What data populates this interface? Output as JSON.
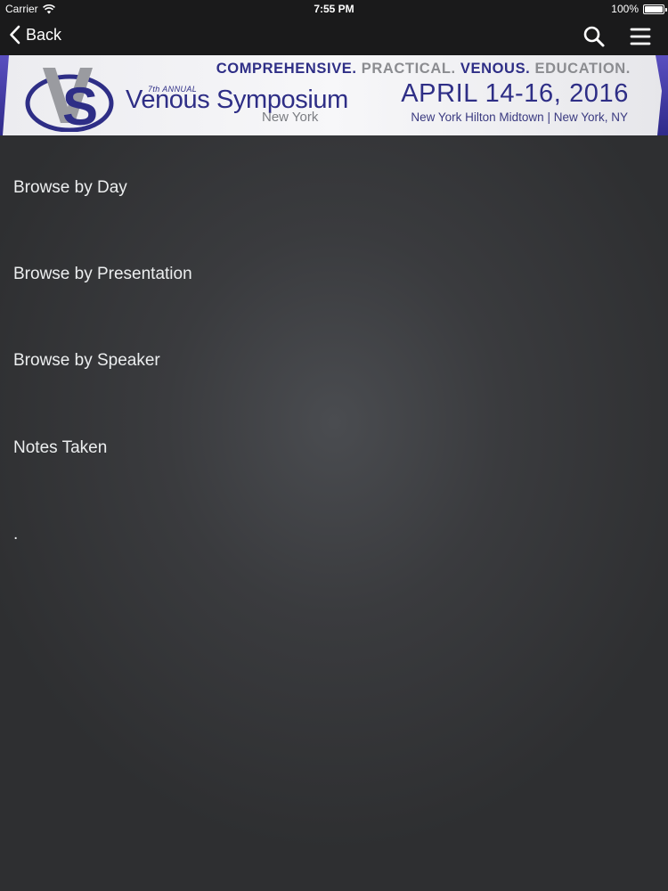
{
  "status_bar": {
    "carrier": "Carrier",
    "time": "7:55 PM",
    "battery": "100%",
    "battery_level": 1.0
  },
  "nav": {
    "back_label": "Back",
    "icons": [
      "search-icon",
      "hamburger-menu-icon",
      "chevron-left-icon"
    ]
  },
  "banner": {
    "tagline": {
      "w1": "COMPREHENSIVE.",
      "w2": "PRACTICAL.",
      "w3": "VENOUS.",
      "w4": "EDUCATION."
    },
    "annual": "7th ANNUAL",
    "title": "Venous Symposium",
    "city": "New York",
    "date": "APRIL 14-16, 2016",
    "venue": "New York Hilton Midtown | New York, NY",
    "colors": {
      "navy": "#2e2e86",
      "gray": "#8b8c90",
      "purple_edge": "#4a3fa8"
    }
  },
  "menu": {
    "items": [
      {
        "label": "Browse by Day"
      },
      {
        "label": "Browse by Presentation"
      },
      {
        "label": "Browse by Speaker"
      },
      {
        "label": "Notes Taken"
      },
      {
        "label": "."
      }
    ]
  }
}
